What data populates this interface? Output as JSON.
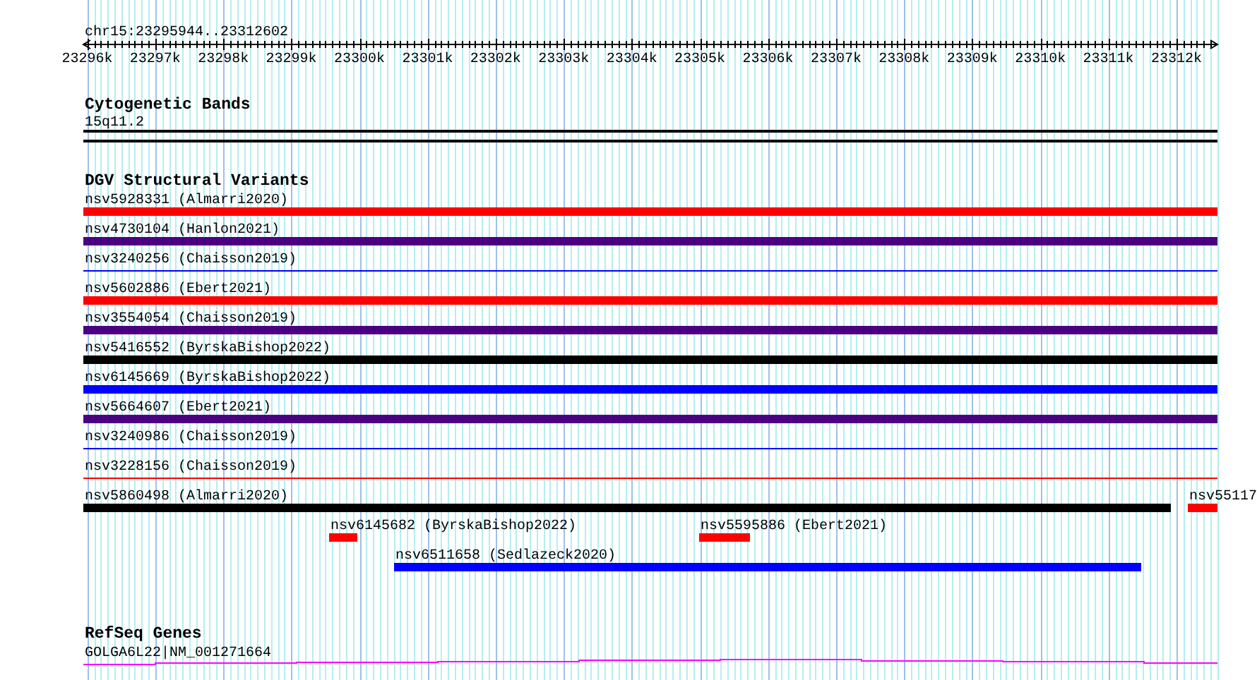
{
  "locus": "chr15:23295944..23312602",
  "ruler": {
    "ticks": [
      "23296k",
      "23297k",
      "23298k",
      "23299k",
      "23300k",
      "23301k",
      "23302k",
      "23303k",
      "23304k",
      "23305k",
      "23306k",
      "23307k",
      "23308k",
      "23309k",
      "23310k",
      "23311k",
      "23312k"
    ]
  },
  "tracks": [
    {
      "title": "Cytogenetic Bands",
      "kind": "cytoband",
      "features": [
        {
          "label": "15q11.2"
        }
      ]
    },
    {
      "title": "DGV Structural Variants",
      "kind": "variants",
      "features": [
        {
          "label": "nsv5928331 (Almarri2020)",
          "color": "#ff0000",
          "kind": "bar"
        },
        {
          "label": "nsv4730104 (Hanlon2021)",
          "color": "#4b0082",
          "kind": "bar"
        },
        {
          "label": "nsv3240256 (Chaisson2019)",
          "color": "#0000ff",
          "kind": "line"
        },
        {
          "label": "nsv5602886 (Ebert2021)",
          "color": "#ff0000",
          "kind": "bar"
        },
        {
          "label": "nsv3554054 (Chaisson2019)",
          "color": "#4b0082",
          "kind": "bar"
        },
        {
          "label": "nsv5416552 (ByrskaBishop2022)",
          "color": "#000000",
          "kind": "bar"
        },
        {
          "label": "nsv6145669 (ByrskaBishop2022)",
          "color": "#0000ff",
          "kind": "bar"
        },
        {
          "label": "nsv5664607 (Ebert2021)",
          "color": "#4b0082",
          "kind": "bar"
        },
        {
          "label": "nsv3240986 (Chaisson2019)",
          "color": "#0000ff",
          "kind": "line"
        },
        {
          "label": "nsv3228156 (Chaisson2019)",
          "color": "#ff0000",
          "kind": "line"
        },
        {
          "label": "nsv5860498 (Almarri2020)",
          "color": "#000000",
          "kind": "bar"
        },
        {
          "label": "nsv55117",
          "color": "#ff0000",
          "kind": "bar"
        },
        {
          "label": "nsv6145682 (ByrskaBishop2022)",
          "color": "#ff0000",
          "kind": "bar"
        },
        {
          "label": "nsv5595886 (Ebert2021)",
          "color": "#ff0000",
          "kind": "bar"
        },
        {
          "label": "nsv6511658 (Sedlazeck2020)",
          "color": "#0000ff",
          "kind": "bar"
        }
      ]
    },
    {
      "title": "RefSeq Genes",
      "kind": "genes",
      "features": [
        {
          "label": "GOLGA6L22|NM_001271664"
        }
      ]
    }
  ]
}
